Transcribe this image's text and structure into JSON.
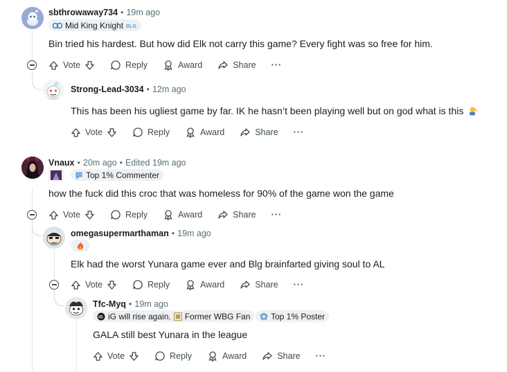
{
  "comments": [
    {
      "user": "sbthrowaway734",
      "time": "19m ago",
      "flair": "Mid King Knight",
      "body": "Bin tried his hardest. But how did Elk not carry this game? Every fight was so free for him."
    },
    {
      "user": "Strong-Lead-3034",
      "time": "12m ago",
      "body": "This has been his ugliest game by far. IK he hasn’t been playing well but on god what is this"
    },
    {
      "user": "Vnaux",
      "time": "20m ago",
      "edited": "Edited 19m ago",
      "flair": "Top 1% Commenter",
      "body": "how the fuck did this croc that was homeless for 90% of the game won the game"
    },
    {
      "user": "omegasupermarthaman",
      "time": "19m ago",
      "body": "Elk had the worst Yunara game ever and Blg brainfarted giving soul to AL"
    },
    {
      "user": "Tfc-Myq",
      "time": "19m ago",
      "flairs": [
        "iG will rise again.",
        "Former WBG Fan",
        "Top 1% Poster"
      ],
      "body": "GALA still best Yunara in the league"
    }
  ],
  "actions": {
    "vote": "Vote",
    "reply": "Reply",
    "award": "Award",
    "share": "Share",
    "more": "···"
  },
  "colors": {
    "meta": "#576f76",
    "thread": "#e5e7ea",
    "flair_bg": "#eef1f3",
    "avatar1": "#8a9bd1"
  }
}
